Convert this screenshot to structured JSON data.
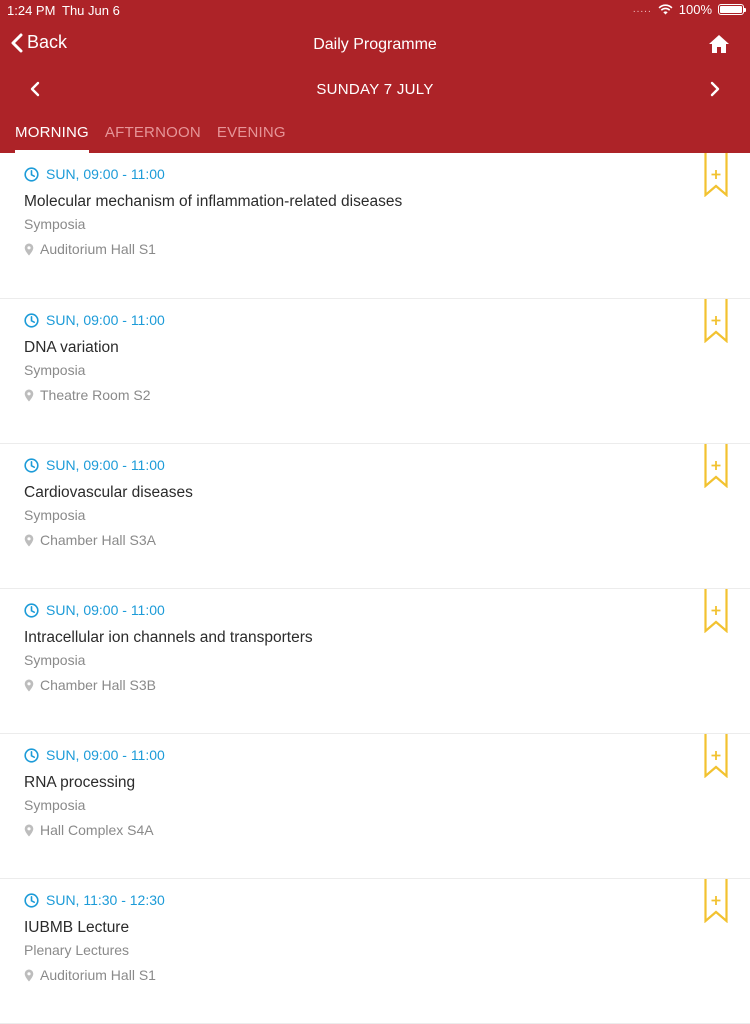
{
  "status_bar": {
    "time": "1:24 PM",
    "date": "Thu Jun 6",
    "battery": "100%",
    "signal": "....."
  },
  "nav": {
    "back_label": "Back",
    "title": "Daily Programme"
  },
  "date_nav": {
    "label": "SUNDAY 7 JULY"
  },
  "tabs": [
    {
      "label": "MORNING",
      "active": true
    },
    {
      "label": "AFTERNOON",
      "active": false
    },
    {
      "label": "EVENING",
      "active": false
    }
  ],
  "sessions": [
    {
      "time": "SUN, 09:00 - 11:00",
      "title": "Molecular mechanism of inflammation-related diseases",
      "type": "Symposia",
      "location": "Auditorium Hall S1"
    },
    {
      "time": "SUN, 09:00 - 11:00",
      "title": "DNA variation",
      "type": "Symposia",
      "location": "Theatre Room S2"
    },
    {
      "time": "SUN, 09:00 - 11:00",
      "title": "Cardiovascular diseases",
      "type": "Symposia",
      "location": "Chamber Hall S3A"
    },
    {
      "time": "SUN, 09:00 - 11:00",
      "title": "Intracellular ion channels and transporters",
      "type": "Symposia",
      "location": "Chamber Hall S3B"
    },
    {
      "time": "SUN, 09:00 - 11:00",
      "title": "RNA processing",
      "type": "Symposia",
      "location": "Hall Complex S4A"
    },
    {
      "time": "SUN, 11:30 - 12:30",
      "title": "IUBMB Lecture",
      "type": "Plenary Lectures",
      "location": "Auditorium Hall S1"
    }
  ],
  "colors": {
    "header": "#ad2328",
    "accent_time": "#1c9bd8",
    "bookmark": "#f2c230"
  }
}
